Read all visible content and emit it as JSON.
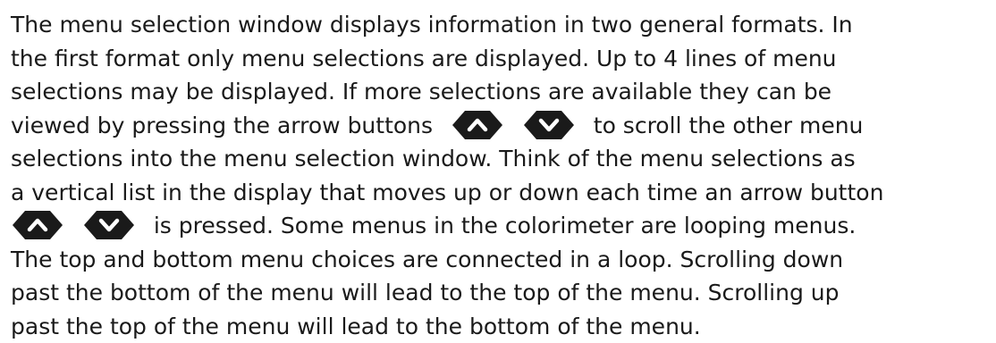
{
  "paragraph": {
    "line1": "The menu selection window displays information in two general formats. In",
    "line2": "the first format only menu selections are displayed. Up to 4 lines of menu",
    "line3": "selections may be displayed. If more selections are available they can be",
    "line4_before": "viewed by pressing the arrow buttons",
    "line4_after": "to scroll the other menu",
    "line5": "selections into the menu selection window. Think of the menu selections as",
    "line6": "a vertical list in the display that moves up or down each time an arrow button",
    "line7_after": "is pressed. Some menus in the colorimeter are looping menus.",
    "line8": "The top and bottom menu choices are connected in a loop. Scrolling down",
    "line9": "past the bottom of the menu will lead to the top of the menu. Scrolling up",
    "line10": "past the top of the menu will lead to the bottom of the menu."
  },
  "icons": {
    "up": "up-arrow-button-icon",
    "down": "down-arrow-button-icon",
    "fill_color": "#1a1a1a",
    "glyph_color": "#ffffff"
  }
}
